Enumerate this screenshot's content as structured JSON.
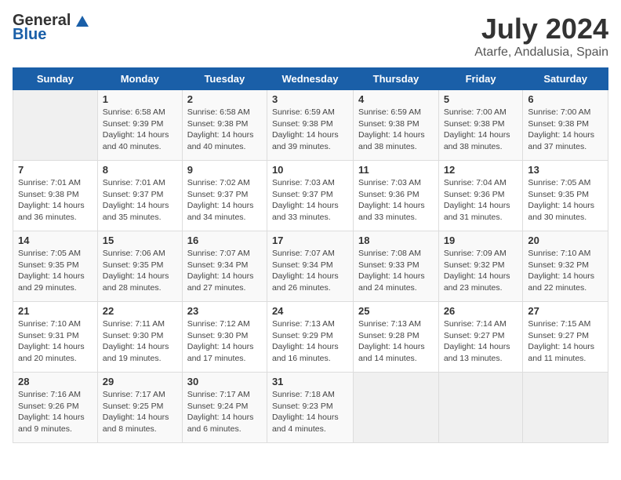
{
  "header": {
    "logo_general": "General",
    "logo_blue": "Blue",
    "month_year": "July 2024",
    "location": "Atarfe, Andalusia, Spain"
  },
  "days_of_week": [
    "Sunday",
    "Monday",
    "Tuesday",
    "Wednesday",
    "Thursday",
    "Friday",
    "Saturday"
  ],
  "weeks": [
    [
      {
        "day": "",
        "sunrise": "",
        "sunset": "",
        "daylight": ""
      },
      {
        "day": "1",
        "sunrise": "Sunrise: 6:58 AM",
        "sunset": "Sunset: 9:39 PM",
        "daylight": "Daylight: 14 hours and 40 minutes."
      },
      {
        "day": "2",
        "sunrise": "Sunrise: 6:58 AM",
        "sunset": "Sunset: 9:38 PM",
        "daylight": "Daylight: 14 hours and 40 minutes."
      },
      {
        "day": "3",
        "sunrise": "Sunrise: 6:59 AM",
        "sunset": "Sunset: 9:38 PM",
        "daylight": "Daylight: 14 hours and 39 minutes."
      },
      {
        "day": "4",
        "sunrise": "Sunrise: 6:59 AM",
        "sunset": "Sunset: 9:38 PM",
        "daylight": "Daylight: 14 hours and 38 minutes."
      },
      {
        "day": "5",
        "sunrise": "Sunrise: 7:00 AM",
        "sunset": "Sunset: 9:38 PM",
        "daylight": "Daylight: 14 hours and 38 minutes."
      },
      {
        "day": "6",
        "sunrise": "Sunrise: 7:00 AM",
        "sunset": "Sunset: 9:38 PM",
        "daylight": "Daylight: 14 hours and 37 minutes."
      }
    ],
    [
      {
        "day": "7",
        "sunrise": "Sunrise: 7:01 AM",
        "sunset": "Sunset: 9:38 PM",
        "daylight": "Daylight: 14 hours and 36 minutes."
      },
      {
        "day": "8",
        "sunrise": "Sunrise: 7:01 AM",
        "sunset": "Sunset: 9:37 PM",
        "daylight": "Daylight: 14 hours and 35 minutes."
      },
      {
        "day": "9",
        "sunrise": "Sunrise: 7:02 AM",
        "sunset": "Sunset: 9:37 PM",
        "daylight": "Daylight: 14 hours and 34 minutes."
      },
      {
        "day": "10",
        "sunrise": "Sunrise: 7:03 AM",
        "sunset": "Sunset: 9:37 PM",
        "daylight": "Daylight: 14 hours and 33 minutes."
      },
      {
        "day": "11",
        "sunrise": "Sunrise: 7:03 AM",
        "sunset": "Sunset: 9:36 PM",
        "daylight": "Daylight: 14 hours and 33 minutes."
      },
      {
        "day": "12",
        "sunrise": "Sunrise: 7:04 AM",
        "sunset": "Sunset: 9:36 PM",
        "daylight": "Daylight: 14 hours and 31 minutes."
      },
      {
        "day": "13",
        "sunrise": "Sunrise: 7:05 AM",
        "sunset": "Sunset: 9:35 PM",
        "daylight": "Daylight: 14 hours and 30 minutes."
      }
    ],
    [
      {
        "day": "14",
        "sunrise": "Sunrise: 7:05 AM",
        "sunset": "Sunset: 9:35 PM",
        "daylight": "Daylight: 14 hours and 29 minutes."
      },
      {
        "day": "15",
        "sunrise": "Sunrise: 7:06 AM",
        "sunset": "Sunset: 9:35 PM",
        "daylight": "Daylight: 14 hours and 28 minutes."
      },
      {
        "day": "16",
        "sunrise": "Sunrise: 7:07 AM",
        "sunset": "Sunset: 9:34 PM",
        "daylight": "Daylight: 14 hours and 27 minutes."
      },
      {
        "day": "17",
        "sunrise": "Sunrise: 7:07 AM",
        "sunset": "Sunset: 9:34 PM",
        "daylight": "Daylight: 14 hours and 26 minutes."
      },
      {
        "day": "18",
        "sunrise": "Sunrise: 7:08 AM",
        "sunset": "Sunset: 9:33 PM",
        "daylight": "Daylight: 14 hours and 24 minutes."
      },
      {
        "day": "19",
        "sunrise": "Sunrise: 7:09 AM",
        "sunset": "Sunset: 9:32 PM",
        "daylight": "Daylight: 14 hours and 23 minutes."
      },
      {
        "day": "20",
        "sunrise": "Sunrise: 7:10 AM",
        "sunset": "Sunset: 9:32 PM",
        "daylight": "Daylight: 14 hours and 22 minutes."
      }
    ],
    [
      {
        "day": "21",
        "sunrise": "Sunrise: 7:10 AM",
        "sunset": "Sunset: 9:31 PM",
        "daylight": "Daylight: 14 hours and 20 minutes."
      },
      {
        "day": "22",
        "sunrise": "Sunrise: 7:11 AM",
        "sunset": "Sunset: 9:30 PM",
        "daylight": "Daylight: 14 hours and 19 minutes."
      },
      {
        "day": "23",
        "sunrise": "Sunrise: 7:12 AM",
        "sunset": "Sunset: 9:30 PM",
        "daylight": "Daylight: 14 hours and 17 minutes."
      },
      {
        "day": "24",
        "sunrise": "Sunrise: 7:13 AM",
        "sunset": "Sunset: 9:29 PM",
        "daylight": "Daylight: 14 hours and 16 minutes."
      },
      {
        "day": "25",
        "sunrise": "Sunrise: 7:13 AM",
        "sunset": "Sunset: 9:28 PM",
        "daylight": "Daylight: 14 hours and 14 minutes."
      },
      {
        "day": "26",
        "sunrise": "Sunrise: 7:14 AM",
        "sunset": "Sunset: 9:27 PM",
        "daylight": "Daylight: 14 hours and 13 minutes."
      },
      {
        "day": "27",
        "sunrise": "Sunrise: 7:15 AM",
        "sunset": "Sunset: 9:27 PM",
        "daylight": "Daylight: 14 hours and 11 minutes."
      }
    ],
    [
      {
        "day": "28",
        "sunrise": "Sunrise: 7:16 AM",
        "sunset": "Sunset: 9:26 PM",
        "daylight": "Daylight: 14 hours and 9 minutes."
      },
      {
        "day": "29",
        "sunrise": "Sunrise: 7:17 AM",
        "sunset": "Sunset: 9:25 PM",
        "daylight": "Daylight: 14 hours and 8 minutes."
      },
      {
        "day": "30",
        "sunrise": "Sunrise: 7:17 AM",
        "sunset": "Sunset: 9:24 PM",
        "daylight": "Daylight: 14 hours and 6 minutes."
      },
      {
        "day": "31",
        "sunrise": "Sunrise: 7:18 AM",
        "sunset": "Sunset: 9:23 PM",
        "daylight": "Daylight: 14 hours and 4 minutes."
      },
      {
        "day": "",
        "sunrise": "",
        "sunset": "",
        "daylight": ""
      },
      {
        "day": "",
        "sunrise": "",
        "sunset": "",
        "daylight": ""
      },
      {
        "day": "",
        "sunrise": "",
        "sunset": "",
        "daylight": ""
      }
    ]
  ]
}
